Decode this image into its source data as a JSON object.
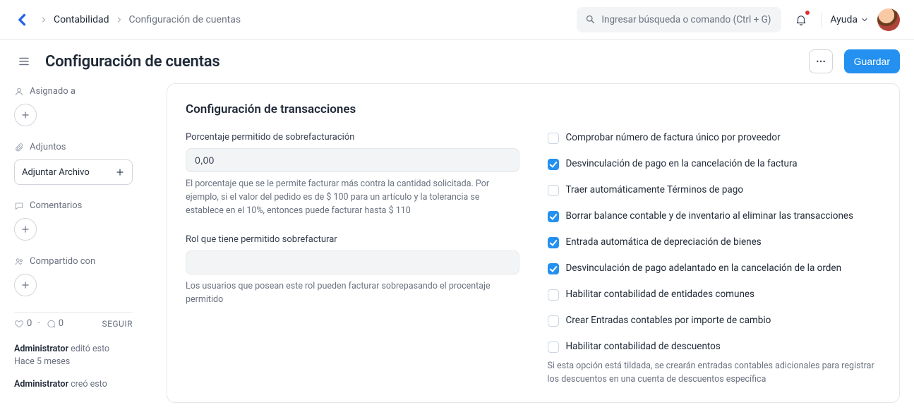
{
  "header": {
    "breadcrumb_parent": "Contabilidad",
    "breadcrumb_current": "Configuración de cuentas",
    "search_placeholder": "Ingresar búsqueda o comando (Ctrl + G)",
    "help_label": "Ayuda"
  },
  "titlebar": {
    "title": "Configuración de cuentas",
    "save_label": "Guardar"
  },
  "sidebar": {
    "assigned_label": "Asignado a",
    "attachments_label": "Adjuntos",
    "attach_btn_label": "Adjuntar Archivo",
    "comments_label": "Comentarios",
    "shared_label": "Compartido con",
    "like_count": "0",
    "comment_count": "0",
    "follow_label": "SEGUIR",
    "timeline": {
      "edit_user": "Administrator",
      "edit_verb": "editó esto",
      "edit_time": "Hace 5 meses",
      "create_user": "Administrator",
      "create_verb": "creó esto"
    }
  },
  "card": {
    "section_title": "Configuración de transacciones",
    "over_billing_pct": {
      "label": "Porcentaje permitido de sobrefacturación",
      "value": "0,00",
      "help": "El porcentaje que se le permite facturar más contra la cantidad solicitada. Por ejemplo, si el valor del pedido es de $ 100 para un artículo y la tolerancia se establece en el 10%, entonces puede facturar hasta $ 110"
    },
    "over_billing_role": {
      "label": "Rol que tiene permitido sobrefacturar",
      "help": "Los usuarios que posean este rol pueden facturar sobrepasando el procentaje permitido"
    },
    "checks": [
      {
        "label": "Comprobar número de factura único por proveedor",
        "checked": false
      },
      {
        "label": "Desvinculación de pago en la cancelación de la factura",
        "checked": true
      },
      {
        "label": "Traer automáticamente Términos de pago",
        "checked": false
      },
      {
        "label": "Borrar balance contable y de inventario al eliminar las transacciones",
        "checked": true
      },
      {
        "label": "Entrada automática de depreciación de bienes",
        "checked": true
      },
      {
        "label": "Desvinculación de pago adelantado en la cancelación de la orden",
        "checked": true
      },
      {
        "label": "Habilitar contabilidad de entidades comunes",
        "checked": false
      },
      {
        "label": "Crear Entradas contables por importe de cambio",
        "checked": false
      },
      {
        "label": "Habilitar contabilidad de descuentos",
        "checked": false
      }
    ],
    "discount_help": "Si esta opción está tildada, se crearán entradas contables adicionales para registrar los descuentos en una cuenta de descuentos específica"
  }
}
